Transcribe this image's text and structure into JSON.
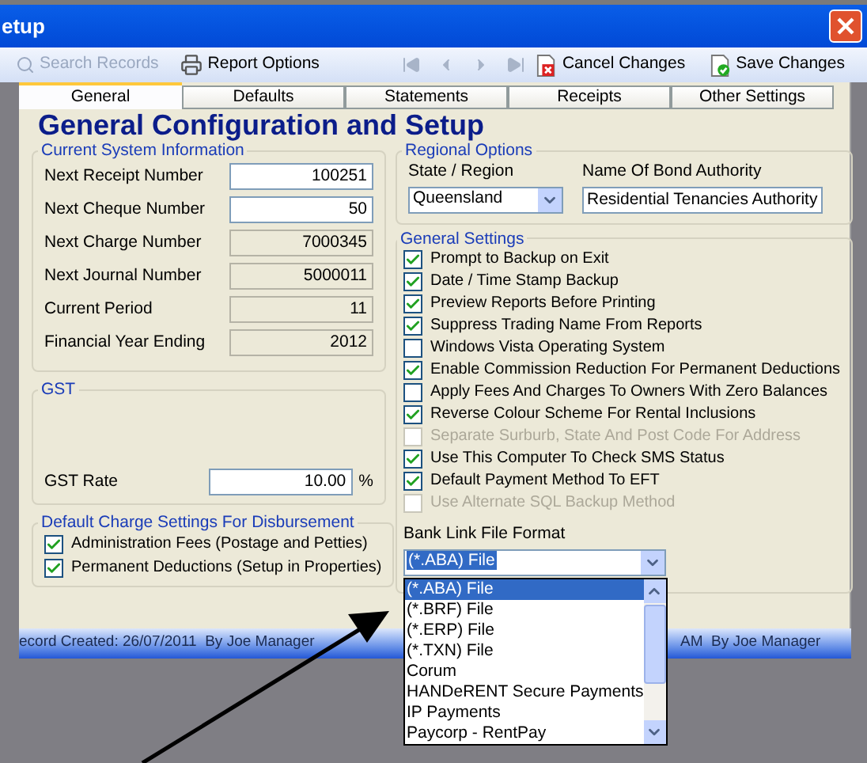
{
  "window": {
    "title": "etup"
  },
  "toolbar": [
    {
      "kind": "search",
      "label": "Search Records",
      "disabled": true
    },
    {
      "kind": "print",
      "label": "Report Options",
      "disabled": false
    },
    {
      "kind": "first",
      "disabled": true
    },
    {
      "kind": "prev",
      "disabled": true
    },
    {
      "kind": "next",
      "disabled": true
    },
    {
      "kind": "last",
      "disabled": true
    },
    {
      "kind": "cancel",
      "label": "Cancel Changes",
      "disabled": false
    },
    {
      "kind": "save",
      "label": "Save Changes",
      "disabled": false
    }
  ],
  "tabs": [
    {
      "label": "General",
      "selected": true
    },
    {
      "label": "Defaults",
      "selected": false
    },
    {
      "label": "Statements",
      "selected": false
    },
    {
      "label": "Receipts",
      "selected": false
    },
    {
      "label": "Other Settings",
      "selected": false
    }
  ],
  "heading": "General Configuration and Setup",
  "current_system_information": {
    "title": "Current System Information",
    "fields": [
      {
        "label": "Next Receipt Number",
        "value": "100251",
        "editable": true
      },
      {
        "label": "Next Cheque Number",
        "value": "50",
        "editable": true
      },
      {
        "label": "Next Charge Number",
        "value": "7000345",
        "editable": false
      },
      {
        "label": "Next Journal Number",
        "value": "5000011",
        "editable": false
      },
      {
        "label": "Current Period",
        "value": "11",
        "editable": false
      },
      {
        "label": "Financial Year Ending",
        "value": "2012",
        "editable": false
      }
    ]
  },
  "gst": {
    "title": "GST",
    "label": "GST Rate",
    "value": "10.00",
    "unit": "%"
  },
  "default_charge_settings": {
    "title": "Default Charge Settings For Disbursement",
    "options": [
      {
        "label": "Administration Fees (Postage and Petties)",
        "checked": true
      },
      {
        "label": "Permanent Deductions (Setup in Properties)",
        "checked": true
      }
    ]
  },
  "regional_options": {
    "title": "Regional Options",
    "state_label": "State / Region",
    "state_value": "Queensland",
    "bond_label": "Name Of Bond Authority",
    "bond_value": "Residential Tenancies Authority"
  },
  "general_settings": {
    "title": "General Settings",
    "options": [
      {
        "label": "Prompt to Backup on Exit",
        "checked": true,
        "disabled": false
      },
      {
        "label": "Date / Time Stamp Backup",
        "checked": true,
        "disabled": false
      },
      {
        "label": "Preview Reports Before Printing",
        "checked": true,
        "disabled": false
      },
      {
        "label": "Suppress Trading Name From Reports",
        "checked": true,
        "disabled": false
      },
      {
        "label": "Windows Vista Operating System",
        "checked": false,
        "disabled": false
      },
      {
        "label": "Enable Commission Reduction For Permanent Deductions",
        "checked": true,
        "disabled": false
      },
      {
        "label": "Apply Fees And Charges To Owners With Zero Balances",
        "checked": false,
        "disabled": false
      },
      {
        "label": "Reverse Colour Scheme For Rental Inclusions",
        "checked": true,
        "disabled": false
      },
      {
        "label": "Separate Surburb, State And Post Code For Address",
        "checked": false,
        "disabled": true
      },
      {
        "label": "Use This Computer To Check SMS Status",
        "checked": true,
        "disabled": false
      },
      {
        "label": "Default Payment Method To EFT",
        "checked": true,
        "disabled": false
      },
      {
        "label": "Use Alternate SQL Backup Method",
        "checked": false,
        "disabled": true
      }
    ],
    "bank_link_label": "Bank Link File Format",
    "bank_link_value": "(*.ABA) File",
    "bank_link_options": [
      {
        "label": "(*.ABA) File",
        "selected": true
      },
      {
        "label": "(*.BRF) File",
        "selected": false
      },
      {
        "label": "(*.ERP) File",
        "selected": false
      },
      {
        "label": "(*.TXN) File",
        "selected": false
      },
      {
        "label": "Corum",
        "selected": false
      },
      {
        "label": "HANDeRENT Secure Payments",
        "selected": false
      },
      {
        "label": "IP Payments",
        "selected": false
      },
      {
        "label": "Paycorp - RentPay",
        "selected": false
      }
    ]
  },
  "status_bar": {
    "left": "ecord Created: 26/07/2011  By Joe Manager",
    "right": "AM  By Joe Manager"
  }
}
